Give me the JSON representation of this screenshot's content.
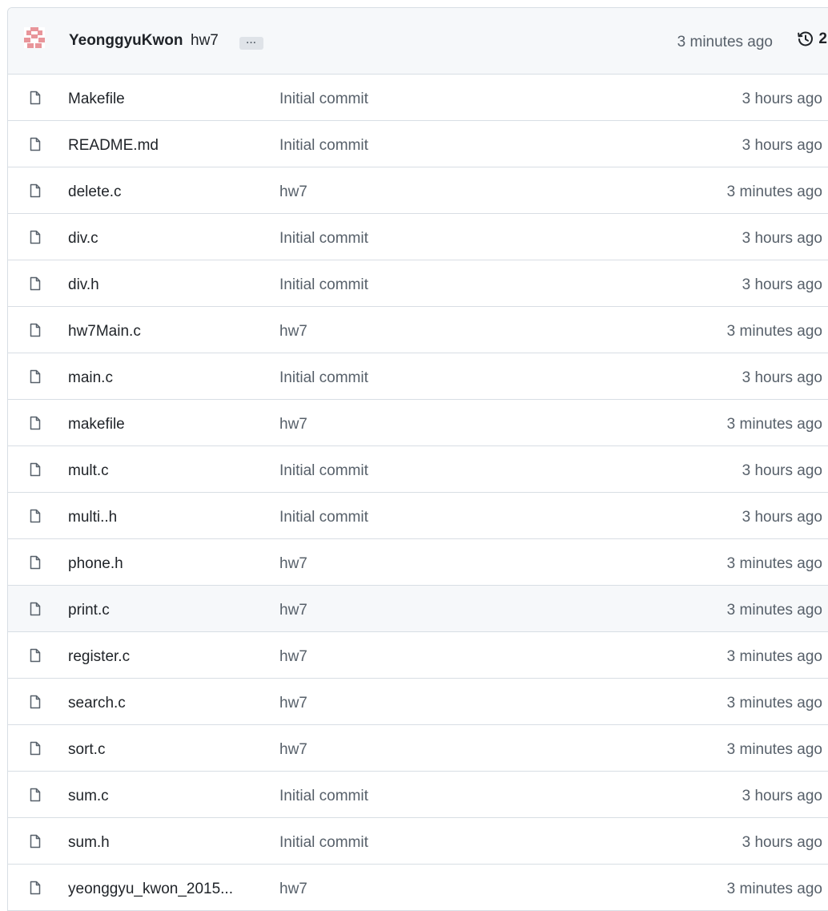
{
  "commit": {
    "author": "YeonggyuKwon",
    "message": "hw7",
    "ellipsis": "...",
    "time": "3 minutes ago",
    "history_count": "2"
  },
  "icons": {
    "avatar": "identicon-avatar",
    "file": "file-icon",
    "history": "history-clock-icon"
  },
  "colors": {
    "header_bg": "#f6f8fa",
    "border": "#d8dee4",
    "muted_text": "#57606a",
    "avatar_pink": "#e8959a"
  },
  "files": [
    {
      "name": "Makefile",
      "message": "Initial commit",
      "time": "3 hours ago"
    },
    {
      "name": "README.md",
      "message": "Initial commit",
      "time": "3 hours ago"
    },
    {
      "name": "delete.c",
      "message": "hw7",
      "time": "3 minutes ago"
    },
    {
      "name": "div.c",
      "message": "Initial commit",
      "time": "3 hours ago"
    },
    {
      "name": "div.h",
      "message": "Initial commit",
      "time": "3 hours ago"
    },
    {
      "name": "hw7Main.c",
      "message": "hw7",
      "time": "3 minutes ago"
    },
    {
      "name": "main.c",
      "message": "Initial commit",
      "time": "3 hours ago"
    },
    {
      "name": "makefile",
      "message": "hw7",
      "time": "3 minutes ago"
    },
    {
      "name": "mult.c",
      "message": "Initial commit",
      "time": "3 hours ago"
    },
    {
      "name": "multi..h",
      "message": "Initial commit",
      "time": "3 hours ago"
    },
    {
      "name": "phone.h",
      "message": "hw7",
      "time": "3 minutes ago"
    },
    {
      "name": "print.c",
      "message": "hw7",
      "time": "3 minutes ago"
    },
    {
      "name": "register.c",
      "message": "hw7",
      "time": "3 minutes ago"
    },
    {
      "name": "search.c",
      "message": "hw7",
      "time": "3 minutes ago"
    },
    {
      "name": "sort.c",
      "message": "hw7",
      "time": "3 minutes ago"
    },
    {
      "name": "sum.c",
      "message": "Initial commit",
      "time": "3 hours ago"
    },
    {
      "name": "sum.h",
      "message": "Initial commit",
      "time": "3 hours ago"
    },
    {
      "name": "yeonggyu_kwon_2015...",
      "message": "hw7",
      "time": "3 minutes ago"
    }
  ]
}
